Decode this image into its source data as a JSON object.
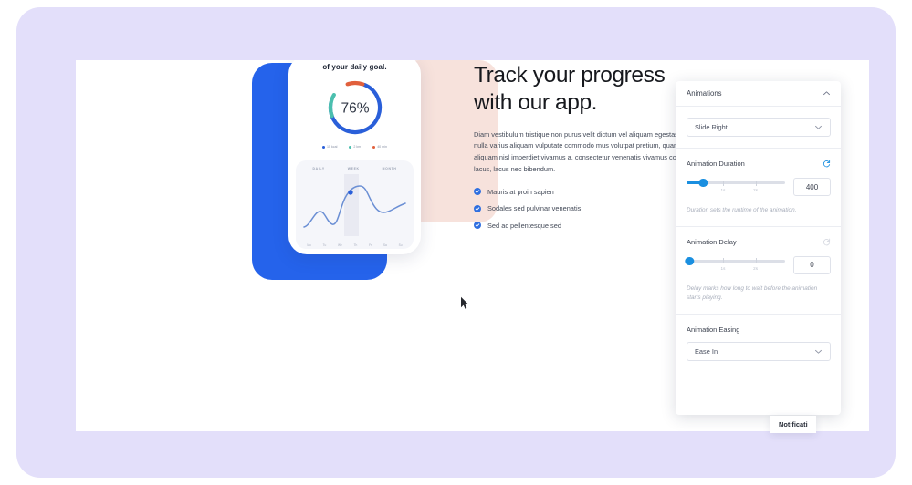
{
  "theme": {
    "frame_bg": "#e3dffa",
    "canvas_bg": "#ffffff",
    "accent_blue": "#2563eb",
    "slider_blue": "#1a8fe0",
    "peach": "#f7e2dc",
    "donut_blue": "#2a5fd9",
    "donut_teal": "#4bbfae",
    "donut_orange": "#e1603c"
  },
  "hero": {
    "title_line1": "Track your progress",
    "title_line2": "with our app.",
    "body": "Diam vestibulum tristique non purus velit dictum vel aliquam egestas odio tortor volutpat nulla varius aliquam vulputate commodo mus volutpat pretium, quam hendrerit enim aliquam nisl imperdiet vivamus a, consectetur venenatis vivamus consectetur vulputate lacus, lacus nec bibendum.",
    "list": [
      "Mauris at proin sapien",
      "Sodales sed pulvinar venenatis",
      "Sed ac pellentesque sed"
    ]
  },
  "phone_mockup": {
    "goal_text": "of your daily goal.",
    "donut_value": "76%",
    "legend": [
      {
        "label": "15 kcal",
        "color": "#2a5fd9"
      },
      {
        "label": "2 km",
        "color": "#4bbfae"
      },
      {
        "label": "40 min",
        "color": "#e1603c"
      }
    ],
    "chart_tabs": [
      "DAILY",
      "WEEK",
      "MONTH"
    ],
    "chart_axis": [
      "Mo",
      "Tu",
      "We",
      "Th",
      "Fr",
      "Sa",
      "Su"
    ]
  },
  "panel": {
    "title": "Animations",
    "collapse_icon": "chevron-up-icon",
    "animation_type": {
      "value": "Slide Right",
      "chevron": "chevron-down-icon"
    },
    "duration": {
      "label": "Animation Duration",
      "reset_icon": "reset-icon",
      "value": "400",
      "tick_labels": [
        "1s",
        "2s"
      ],
      "helper": "Duration sets the runtime of the animation."
    },
    "delay": {
      "label": "Animation Delay",
      "reset_icon": "reset-icon",
      "value": "0",
      "tick_labels": [
        "1s",
        "2s"
      ],
      "helper": "Delay marks how long to wait before the animation starts playing."
    },
    "easing": {
      "label": "Animation Easing",
      "value": "Ease In",
      "chevron": "chevron-down-icon"
    }
  },
  "notification": {
    "label": "Notificati"
  }
}
